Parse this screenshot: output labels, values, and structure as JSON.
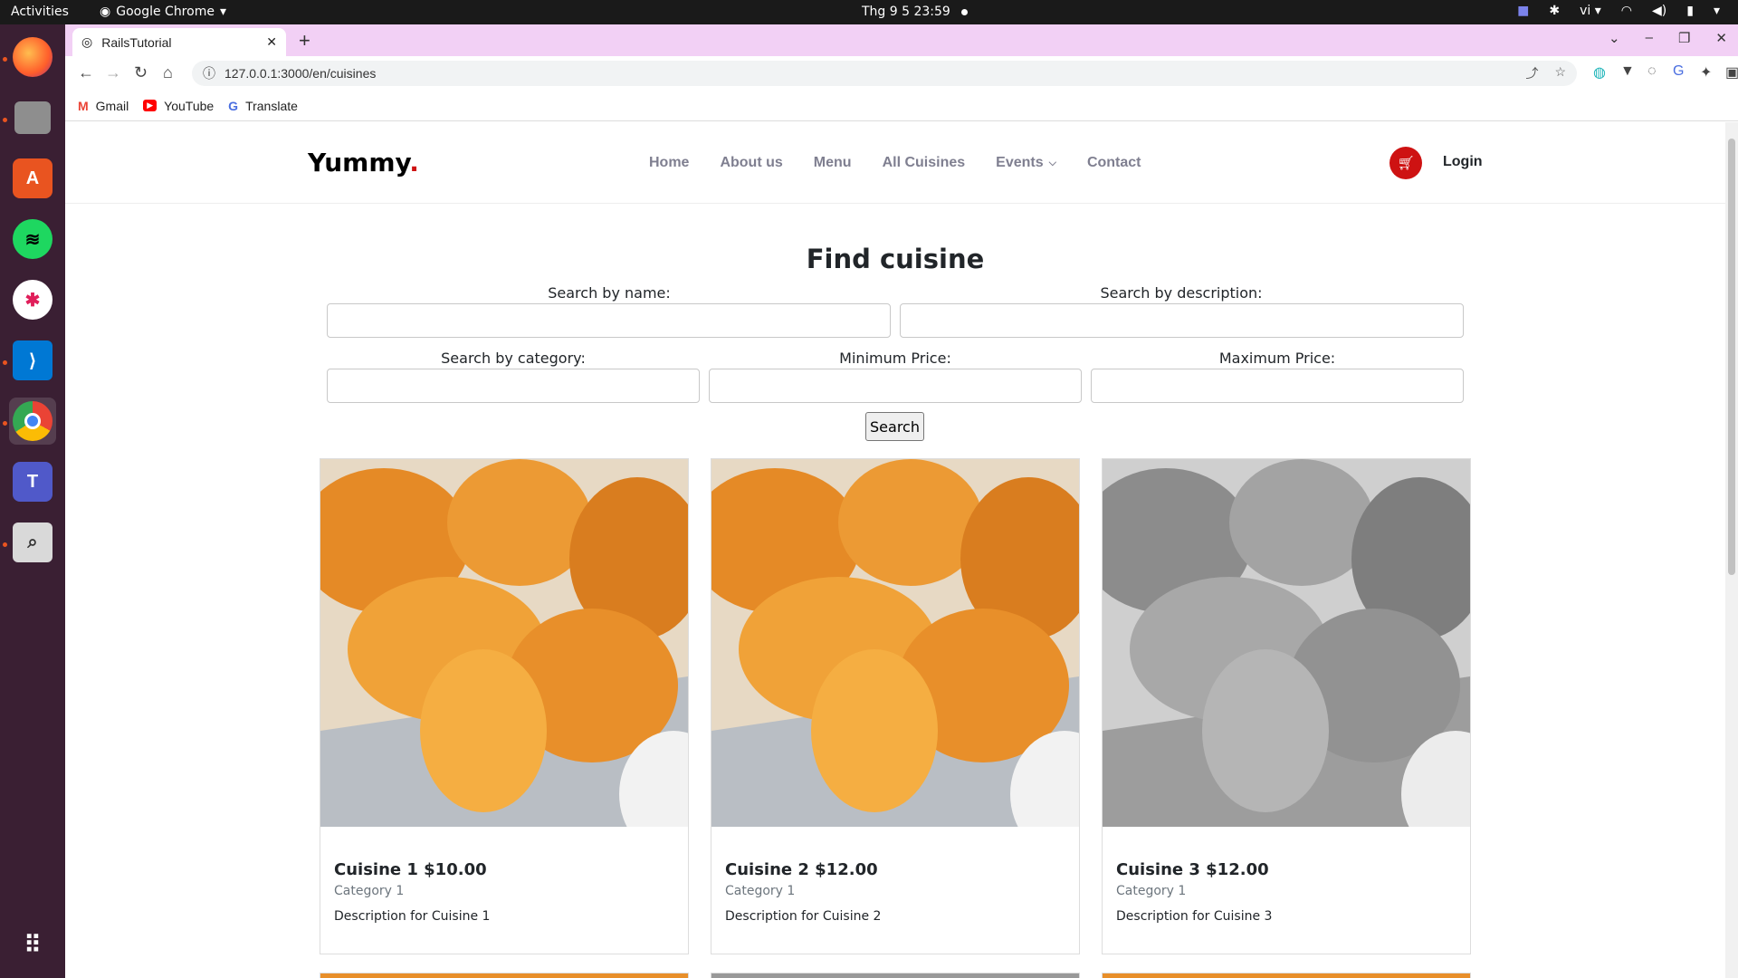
{
  "system": {
    "activities": "Activities",
    "app_name": "Google Chrome",
    "clock": "Thg 9 5  23:59",
    "lang": "vi"
  },
  "browser": {
    "tab_title": "RailsTutorial",
    "url": "127.0.0.1:3000/en/cuisines",
    "bookmarks": [
      "Gmail",
      "YouTube",
      "Translate"
    ]
  },
  "site": {
    "logo": "Yummy",
    "logo_dot": ".",
    "nav": [
      "Home",
      "About us",
      "Menu",
      "All Cuisines",
      "Events",
      "Contact"
    ],
    "login": "Login"
  },
  "search": {
    "title": "Find cuisine",
    "name_label": "Search by name:",
    "description_label": "Search by description:",
    "category_label": "Search by category:",
    "min_price_label": "Minimum Price:",
    "max_price_label": "Maximum Price:",
    "button": "Search"
  },
  "cuisines": [
    {
      "title": "Cuisine 1 $10.00",
      "category": "Category 1",
      "description": "Description for Cuisine 1",
      "grayscale": false
    },
    {
      "title": "Cuisine 2 $12.00",
      "category": "Category 1",
      "description": "Description for Cuisine 2",
      "grayscale": false
    },
    {
      "title": "Cuisine 3 $12.00",
      "category": "Category 1",
      "description": "Description for Cuisine 3",
      "grayscale": true
    }
  ],
  "colors": {
    "brand_red": "#ce1212",
    "tabstrip": "#f2d0f5",
    "dock": "#3a1f33"
  }
}
